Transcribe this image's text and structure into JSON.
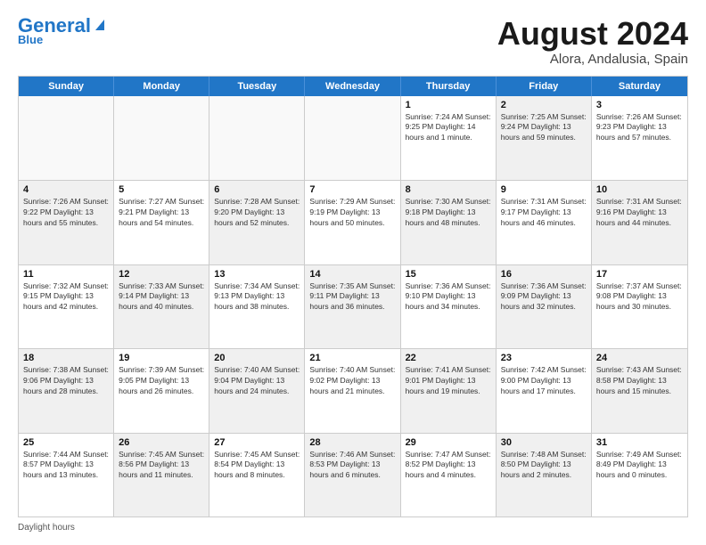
{
  "logo": {
    "text1": "General",
    "text2": "Blue"
  },
  "title": "August 2024",
  "subtitle": "Alora, Andalusia, Spain",
  "days_of_week": [
    "Sunday",
    "Monday",
    "Tuesday",
    "Wednesday",
    "Thursday",
    "Friday",
    "Saturday"
  ],
  "footer_text": "Daylight hours",
  "weeks": [
    [
      {
        "day": "",
        "info": "",
        "empty": true
      },
      {
        "day": "",
        "info": "",
        "empty": true
      },
      {
        "day": "",
        "info": "",
        "empty": true
      },
      {
        "day": "",
        "info": "",
        "empty": true
      },
      {
        "day": "1",
        "info": "Sunrise: 7:24 AM\nSunset: 9:25 PM\nDaylight: 14 hours\nand 1 minute.",
        "empty": false
      },
      {
        "day": "2",
        "info": "Sunrise: 7:25 AM\nSunset: 9:24 PM\nDaylight: 13 hours\nand 59 minutes.",
        "empty": false,
        "shaded": true
      },
      {
        "day": "3",
        "info": "Sunrise: 7:26 AM\nSunset: 9:23 PM\nDaylight: 13 hours\nand 57 minutes.",
        "empty": false
      }
    ],
    [
      {
        "day": "4",
        "info": "Sunrise: 7:26 AM\nSunset: 9:22 PM\nDaylight: 13 hours\nand 55 minutes.",
        "empty": false,
        "shaded": true
      },
      {
        "day": "5",
        "info": "Sunrise: 7:27 AM\nSunset: 9:21 PM\nDaylight: 13 hours\nand 54 minutes.",
        "empty": false
      },
      {
        "day": "6",
        "info": "Sunrise: 7:28 AM\nSunset: 9:20 PM\nDaylight: 13 hours\nand 52 minutes.",
        "empty": false,
        "shaded": true
      },
      {
        "day": "7",
        "info": "Sunrise: 7:29 AM\nSunset: 9:19 PM\nDaylight: 13 hours\nand 50 minutes.",
        "empty": false
      },
      {
        "day": "8",
        "info": "Sunrise: 7:30 AM\nSunset: 9:18 PM\nDaylight: 13 hours\nand 48 minutes.",
        "empty": false,
        "shaded": true
      },
      {
        "day": "9",
        "info": "Sunrise: 7:31 AM\nSunset: 9:17 PM\nDaylight: 13 hours\nand 46 minutes.",
        "empty": false
      },
      {
        "day": "10",
        "info": "Sunrise: 7:31 AM\nSunset: 9:16 PM\nDaylight: 13 hours\nand 44 minutes.",
        "empty": false,
        "shaded": true
      }
    ],
    [
      {
        "day": "11",
        "info": "Sunrise: 7:32 AM\nSunset: 9:15 PM\nDaylight: 13 hours\nand 42 minutes.",
        "empty": false
      },
      {
        "day": "12",
        "info": "Sunrise: 7:33 AM\nSunset: 9:14 PM\nDaylight: 13 hours\nand 40 minutes.",
        "empty": false,
        "shaded": true
      },
      {
        "day": "13",
        "info": "Sunrise: 7:34 AM\nSunset: 9:13 PM\nDaylight: 13 hours\nand 38 minutes.",
        "empty": false
      },
      {
        "day": "14",
        "info": "Sunrise: 7:35 AM\nSunset: 9:11 PM\nDaylight: 13 hours\nand 36 minutes.",
        "empty": false,
        "shaded": true
      },
      {
        "day": "15",
        "info": "Sunrise: 7:36 AM\nSunset: 9:10 PM\nDaylight: 13 hours\nand 34 minutes.",
        "empty": false
      },
      {
        "day": "16",
        "info": "Sunrise: 7:36 AM\nSunset: 9:09 PM\nDaylight: 13 hours\nand 32 minutes.",
        "empty": false,
        "shaded": true
      },
      {
        "day": "17",
        "info": "Sunrise: 7:37 AM\nSunset: 9:08 PM\nDaylight: 13 hours\nand 30 minutes.",
        "empty": false
      }
    ],
    [
      {
        "day": "18",
        "info": "Sunrise: 7:38 AM\nSunset: 9:06 PM\nDaylight: 13 hours\nand 28 minutes.",
        "empty": false,
        "shaded": true
      },
      {
        "day": "19",
        "info": "Sunrise: 7:39 AM\nSunset: 9:05 PM\nDaylight: 13 hours\nand 26 minutes.",
        "empty": false
      },
      {
        "day": "20",
        "info": "Sunrise: 7:40 AM\nSunset: 9:04 PM\nDaylight: 13 hours\nand 24 minutes.",
        "empty": false,
        "shaded": true
      },
      {
        "day": "21",
        "info": "Sunrise: 7:40 AM\nSunset: 9:02 PM\nDaylight: 13 hours\nand 21 minutes.",
        "empty": false
      },
      {
        "day": "22",
        "info": "Sunrise: 7:41 AM\nSunset: 9:01 PM\nDaylight: 13 hours\nand 19 minutes.",
        "empty": false,
        "shaded": true
      },
      {
        "day": "23",
        "info": "Sunrise: 7:42 AM\nSunset: 9:00 PM\nDaylight: 13 hours\nand 17 minutes.",
        "empty": false
      },
      {
        "day": "24",
        "info": "Sunrise: 7:43 AM\nSunset: 8:58 PM\nDaylight: 13 hours\nand 15 minutes.",
        "empty": false,
        "shaded": true
      }
    ],
    [
      {
        "day": "25",
        "info": "Sunrise: 7:44 AM\nSunset: 8:57 PM\nDaylight: 13 hours\nand 13 minutes.",
        "empty": false
      },
      {
        "day": "26",
        "info": "Sunrise: 7:45 AM\nSunset: 8:56 PM\nDaylight: 13 hours\nand 11 minutes.",
        "empty": false,
        "shaded": true
      },
      {
        "day": "27",
        "info": "Sunrise: 7:45 AM\nSunset: 8:54 PM\nDaylight: 13 hours\nand 8 minutes.",
        "empty": false
      },
      {
        "day": "28",
        "info": "Sunrise: 7:46 AM\nSunset: 8:53 PM\nDaylight: 13 hours\nand 6 minutes.",
        "empty": false,
        "shaded": true
      },
      {
        "day": "29",
        "info": "Sunrise: 7:47 AM\nSunset: 8:52 PM\nDaylight: 13 hours\nand 4 minutes.",
        "empty": false
      },
      {
        "day": "30",
        "info": "Sunrise: 7:48 AM\nSunset: 8:50 PM\nDaylight: 13 hours\nand 2 minutes.",
        "empty": false,
        "shaded": true
      },
      {
        "day": "31",
        "info": "Sunrise: 7:49 AM\nSunset: 8:49 PM\nDaylight: 13 hours\nand 0 minutes.",
        "empty": false
      }
    ]
  ]
}
